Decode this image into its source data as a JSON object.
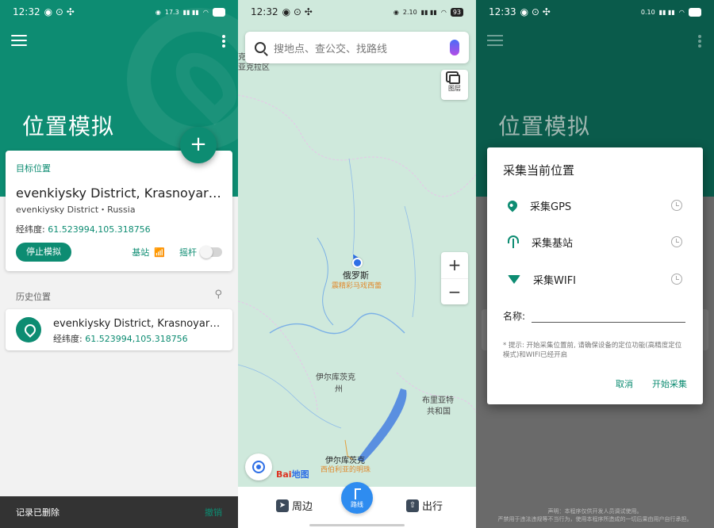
{
  "screen1": {
    "status": {
      "time": "12:32",
      "battery": "93",
      "net": "17.3",
      "net_unit": "KB/s"
    },
    "title": "位置模拟",
    "fab_label": "+",
    "target": {
      "label": "目标位置",
      "name": "evenkiysky District, Krasnoyarsk Krai, Russia",
      "sub": "evenkiysky District・Russia",
      "coord_label": "经纬度:",
      "coord_value": "61.523994,105.318756",
      "stop_button": "停止模拟",
      "base_station": "基站",
      "joystick": "摇杆"
    },
    "history": {
      "label": "历史位置",
      "items": [
        {
          "name": "evenkiysky District, Krasnoyarsk Krai, Russia",
          "coord_label": "经纬度:",
          "coord_value": "61.523994,105.318756"
        }
      ]
    },
    "snackbar": {
      "message": "记录已删除",
      "action": "撤销"
    }
  },
  "screen2": {
    "status": {
      "time": "12:32",
      "battery": "93",
      "net": "2.10",
      "net_unit": "MB/s"
    },
    "search_placeholder": "搜地点、查公交、找路线",
    "layers_label": "图层",
    "zoom_in": "+",
    "zoom_out": "−",
    "map_labels": {
      "russia": "俄罗斯",
      "russia_sub": "震精彩马戏西蕾",
      "irkutsk_oblast": "伊尔库茨克",
      "irkutsk_oblast2": "州",
      "buryatia": "布里亚特",
      "buryatia2": "共和国",
      "irkutsk_city": "伊尔库茨克",
      "irkutsk_sub": "西伯利亚的明珠",
      "top_left": "克勒",
      "top_left2": "亚克拉区"
    },
    "baidu": {
      "part1": "Bai",
      "part2": "地图"
    },
    "nav": {
      "nearby": "周边",
      "route": "路线",
      "travel": "出行"
    }
  },
  "screen3": {
    "status": {
      "time": "12:33",
      "battery": "93",
      "net": "0.10",
      "net_unit": "KB/s"
    },
    "title": "位置模拟",
    "dialog": {
      "title": "采集当前位置",
      "options": [
        "采集GPS",
        "采集基站",
        "采集WIFI"
      ],
      "name_label": "名称:",
      "tip": "* 提示: 开始采集位置前, 请确保设备的定位功能(高精度定位模式)和WIFI已经开启",
      "cancel": "取消",
      "start": "开始采集"
    },
    "footer1": "声明：本程序仅供开发人员调试使用。",
    "footer2": "严禁用于违法违规等不当行为，使用本程序所造成的一切后果由用户自行承担。"
  },
  "colors": {
    "accent": "#0d8c72",
    "map_blue": "#2e6fe6"
  }
}
